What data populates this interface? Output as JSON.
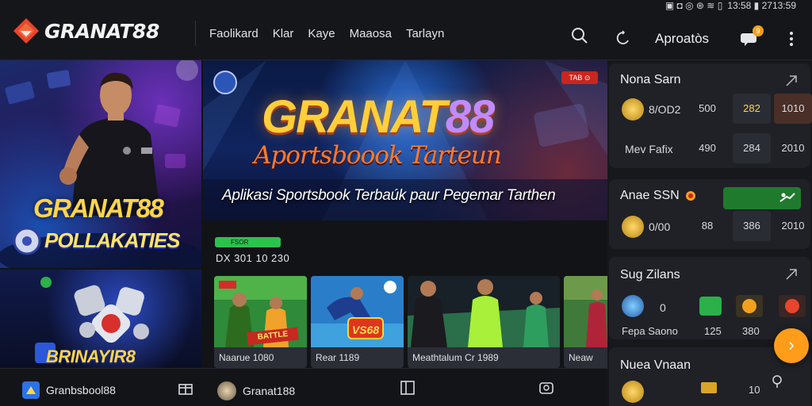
{
  "status_bar": {
    "left_glyphs": "▣ ◘ ◎ ⊛ ≋ ▯",
    "clock": "13:58  ▮  2713:59"
  },
  "header": {
    "brand": "GRANAT88",
    "nav": [
      "Faolikard",
      "Klar",
      "Kaye",
      "Maaosa",
      "Tarlayn"
    ],
    "approvals_label": "Aproatòs",
    "notification_badge": "9"
  },
  "left_promo": {
    "top_title": "GRANAT88",
    "top_sub": "POLLAKATIES",
    "bottom_title": "BRINAYIR8"
  },
  "hero": {
    "title_a": "GRANAT",
    "title_b": "88",
    "subtitle": "Aportsboook Tarteun",
    "caption": "Aplikasi Sportsbook Terbaúk paur Pegemar Tarthen",
    "badge": "TAB ⊙"
  },
  "live": {
    "tag": "FSOR",
    "code": "DX 301 10 230"
  },
  "cards": [
    {
      "label": "Naarue 1080",
      "banner": "BATTLE"
    },
    {
      "label": "Rear 1189",
      "banner": "VS68"
    },
    {
      "label": "Meathtalum Cr 1989",
      "banner": ""
    },
    {
      "label": "Neaw",
      "banner": ""
    }
  ],
  "sidebar": {
    "panel1": {
      "title": "Nona Sarn",
      "rows": [
        {
          "label": "8/OD2",
          "odds": [
            "500",
            "282",
            "1010"
          ]
        },
        {
          "label": "Mev Fafix",
          "odds": [
            "490",
            "284",
            "2010"
          ]
        }
      ]
    },
    "panel2": {
      "title": "Anae SSN",
      "rows": [
        {
          "label": "0/00",
          "odds": [
            "88",
            "386",
            "2010"
          ]
        }
      ]
    },
    "panel3": {
      "title": "Sug Zilans",
      "row_label": "Fepa Saono",
      "zero": "0",
      "odds": [
        "125",
        "380"
      ]
    },
    "panel4": {
      "title": "Nuea Vnaan",
      "value": "10"
    }
  },
  "bottom_bar": {
    "left_label": "Granbsbool88",
    "mid_label": "Granat188"
  },
  "colors": {
    "accent_orange": "#ff9c1a",
    "live_green": "#2bc24b",
    "brand_red": "#e8452c",
    "gold": "#ffcf3a"
  }
}
